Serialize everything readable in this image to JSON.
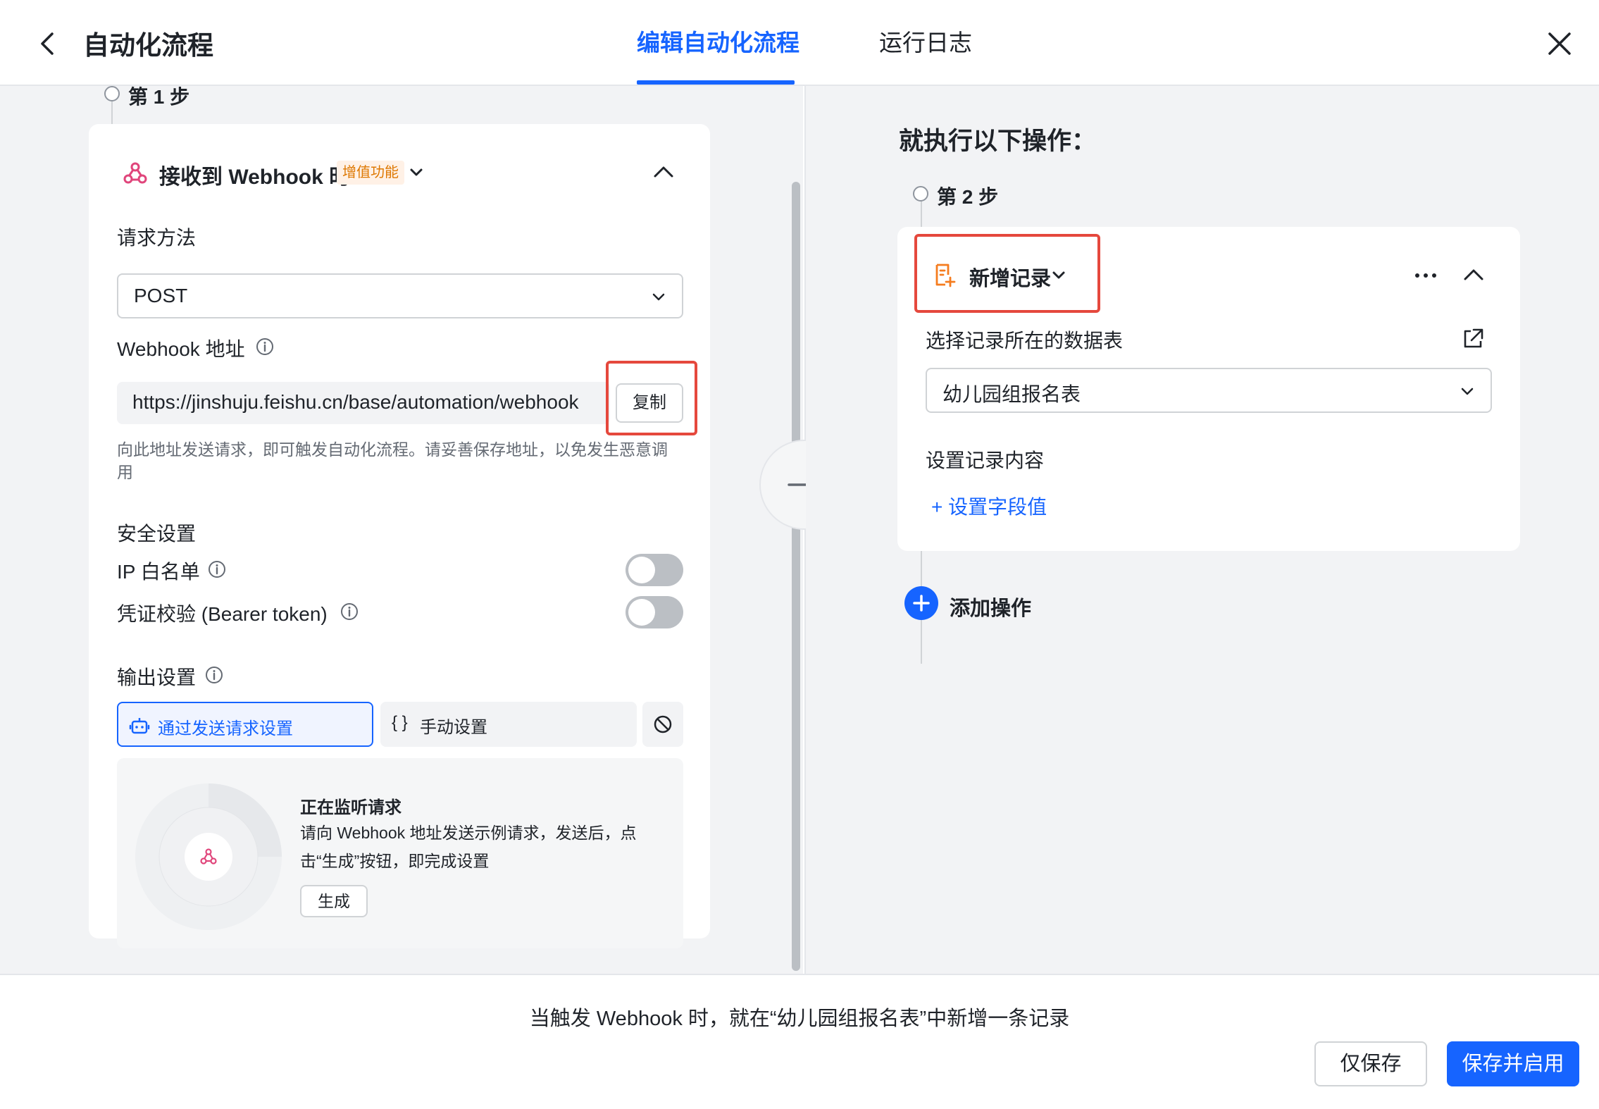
{
  "header": {
    "title": "自动化流程",
    "tabs": [
      {
        "label": "编辑自动化流程",
        "active": true
      },
      {
        "label": "运行日志",
        "active": false
      }
    ]
  },
  "left": {
    "step_label": "第 1 步",
    "trigger": {
      "title": "接收到 Webhook 时",
      "badge": "增值功能",
      "icon": "webhook-icon"
    },
    "method": {
      "label": "请求方法",
      "value": "POST"
    },
    "webhook": {
      "label": "Webhook 地址",
      "url": "https://jinshuju.feishu.cn/base/automation/webhook",
      "copy_label": "复制",
      "hint": "向此地址发送请求，即可触发自动化流程。请妥善保存地址，以免发生恶意调用"
    },
    "security": {
      "title": "安全设置",
      "ip_whitelist": {
        "label": "IP 白名单",
        "enabled": false
      },
      "bearer": {
        "label": "凭证校验 (Bearer token)",
        "enabled": false
      }
    },
    "output": {
      "title": "输出设置",
      "options": [
        {
          "label": "通过发送请求设置",
          "icon": "robot-icon",
          "active": true
        },
        {
          "label": "手动设置",
          "icon": "braces-icon",
          "prefix": "{ }",
          "active": false
        }
      ],
      "disable_icon": "ban-icon"
    },
    "listening": {
      "title": "正在监听请求",
      "desc": "请向 Webhook 地址发送示例请求，发送后，点击“生成”按钮，即完成设置",
      "button": "生成"
    }
  },
  "right": {
    "section_title": "就执行以下操作：",
    "step_label": "第 2 步",
    "action": {
      "title": "新增记录",
      "icon": "add-record-icon"
    },
    "table_select": {
      "label": "选择记录所在的数据表",
      "value": "幼儿园组报名表"
    },
    "content": {
      "label": "设置记录内容",
      "add_field": "设置字段值",
      "add_prefix": "+"
    },
    "add_operation": "添加操作"
  },
  "footer": {
    "summary": "当触发 Webhook 时，就在“幼儿园组报名表”中新增一条记录",
    "save_only": "仅保存",
    "save_enable": "保存并启用"
  },
  "colors": {
    "primary": "#1664ff",
    "highlight": "#e5483d",
    "badge": "#de7802",
    "webhook": "#e0457b",
    "action": "#f57c1f"
  }
}
